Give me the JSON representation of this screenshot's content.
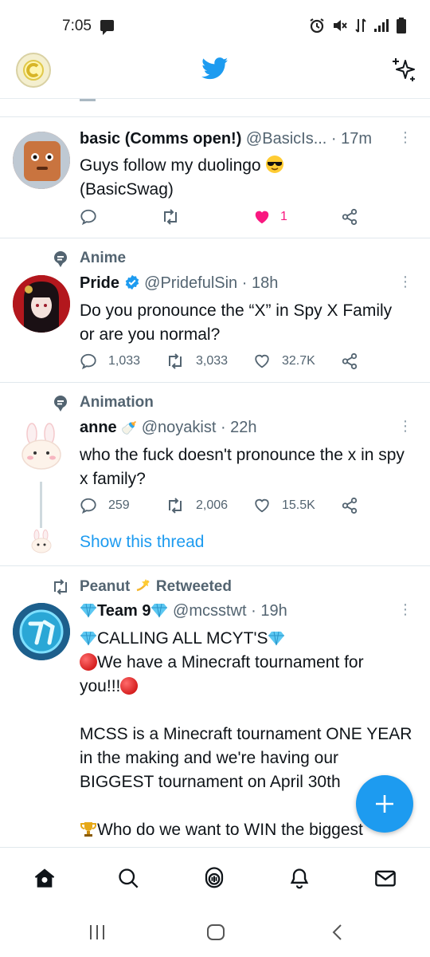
{
  "status_bar": {
    "time": "7:05"
  },
  "top_bar": {
    "logo": "twitter-bird-icon",
    "accent": "#1d9bf0"
  },
  "tweets": [
    {
      "name": "basic (Comms open!)",
      "handle": "@BasicIs...",
      "time": "· 17m",
      "text_line1": "Guys follow my duolingo",
      "text_line2": "(BasicSwag)",
      "likes": "1"
    },
    {
      "context": "Anime",
      "name": "Pride",
      "handle": "@PridefulSin",
      "time": "· 18h",
      "text": "Do you pronounce the “X” in Spy X Family or are you normal?",
      "replies": "1,033",
      "retweets": "3,033",
      "likes": "32.7K"
    },
    {
      "context": "Animation",
      "name": "anne",
      "name_symbol": "🍼",
      "handle": "@noyakist",
      "time": "· 22h",
      "text": "who the fuck doesn't pronounce the x in spy x family?",
      "replies": "259",
      "retweets": "2,006",
      "likes": "15.5K",
      "show_thread": "Show this thread"
    },
    {
      "retweeted_by": "Peanut",
      "retweeted_suffix": "Retweeted",
      "name": "Team 9",
      "handle": "@mcsstwt",
      "time": "· 19h",
      "line1": "CALLING ALL MCYT'S",
      "line2": "We have a Minecraft tournament for",
      "line3": "you!!!",
      "para2": "MCSS is a Minecraft tournament ONE YEAR in the making and we're having our BIGGEST tournament on April 30th",
      "para3": "Who do we want to WIN the biggest"
    }
  ],
  "colors": {
    "accent": "#1d9bf0",
    "like": "#f91880",
    "muted": "#536471"
  }
}
